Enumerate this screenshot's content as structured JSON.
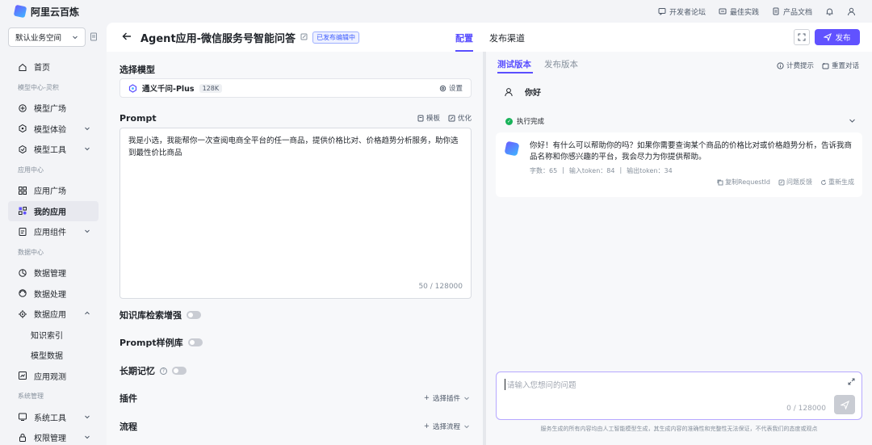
{
  "topbar": {
    "brand": "阿里云百炼",
    "links": [
      {
        "label": "开发者论坛",
        "icon": "forum-icon"
      },
      {
        "label": "最佳实践",
        "icon": "practice-icon"
      },
      {
        "label": "产品文档",
        "icon": "doc-icon"
      }
    ]
  },
  "sidebar": {
    "workspace": "默认业务空间",
    "nav": [
      {
        "type": "item",
        "label": "首页",
        "icon": "home-icon"
      },
      {
        "type": "group",
        "label": "模型中心-灵积"
      },
      {
        "type": "item",
        "label": "模型广场",
        "icon": "model-square-icon"
      },
      {
        "type": "item",
        "label": "模型体验",
        "icon": "model-try-icon",
        "chevron": true
      },
      {
        "type": "item",
        "label": "模型工具",
        "icon": "model-tools-icon",
        "chevron": true
      },
      {
        "type": "group",
        "label": "应用中心"
      },
      {
        "type": "item",
        "label": "应用广场",
        "icon": "app-square-icon"
      },
      {
        "type": "item",
        "label": "我的应用",
        "icon": "my-apps-icon",
        "active": true
      },
      {
        "type": "item",
        "label": "应用组件",
        "icon": "app-components-icon",
        "chevron": true
      },
      {
        "type": "group",
        "label": "数据中心"
      },
      {
        "type": "item",
        "label": "数据管理",
        "icon": "data-manage-icon"
      },
      {
        "type": "item",
        "label": "数据处理",
        "icon": "data-process-icon"
      },
      {
        "type": "item",
        "label": "数据应用",
        "icon": "data-app-icon",
        "chevron": true,
        "expanded": true
      },
      {
        "type": "sub",
        "label": "知识索引"
      },
      {
        "type": "sub",
        "label": "模型数据"
      },
      {
        "type": "item",
        "label": "应用观测",
        "icon": "app-observe-icon"
      },
      {
        "type": "group",
        "label": "系统管理"
      },
      {
        "type": "item",
        "label": "系统工具",
        "icon": "system-tools-icon",
        "chevron": true
      },
      {
        "type": "item",
        "label": "权限管理",
        "icon": "permission-icon",
        "chevron": true
      }
    ]
  },
  "header": {
    "title": "Agent应用-微信服务号智能问答",
    "badge": "已发布编辑中",
    "tabs": [
      "配置",
      "发布渠道"
    ],
    "publish_label": "发布"
  },
  "config": {
    "model_section": "选择模型",
    "model_name": "通义千问-Plus",
    "model_ctx": "128K",
    "model_settings": "设置",
    "prompt_section": "Prompt",
    "prompt_template": "模板",
    "prompt_optimize": "优化",
    "prompt_text": "我是小选，我能帮你一次查阅电商全平台的任一商品，提供价格比对、价格趋势分析服务，助你选到最性价比商品",
    "prompt_count": "50 / 128000",
    "kb_label": "知识库检索增强",
    "prompt_lib_label": "Prompt样例库",
    "memory_label": "长期记忆",
    "plugin_label": "插件",
    "plugin_action": "选择插件",
    "flow_label": "流程",
    "flow_action": "选择流程"
  },
  "test": {
    "tabs": [
      "测试版本",
      "发布版本"
    ],
    "billing": "计费提示",
    "reset": "重置对话",
    "user_msg": "你好",
    "status": "执行完成",
    "reply": "你好！有什么可以帮助你的吗？如果你需要查询某个商品的价格比对或价格趋势分析，告诉我商品名称和你感兴趣的平台，我会尽力为你提供帮助。",
    "meta": [
      "字数：65",
      "输入token：84",
      "输出token：34"
    ],
    "actions": [
      "复制RequestId",
      "问题反馈",
      "重新生成"
    ],
    "input_placeholder": "请输入您想问的问题",
    "input_count": "0 / 128000",
    "disclaimer": "服务生成的所有内容均由人工智能模型生成，其生成内容的准确性和完整性无法保证，不代表我们的态度或观点"
  },
  "colors": {
    "accent": "#6152ff",
    "success": "#19b35a"
  }
}
